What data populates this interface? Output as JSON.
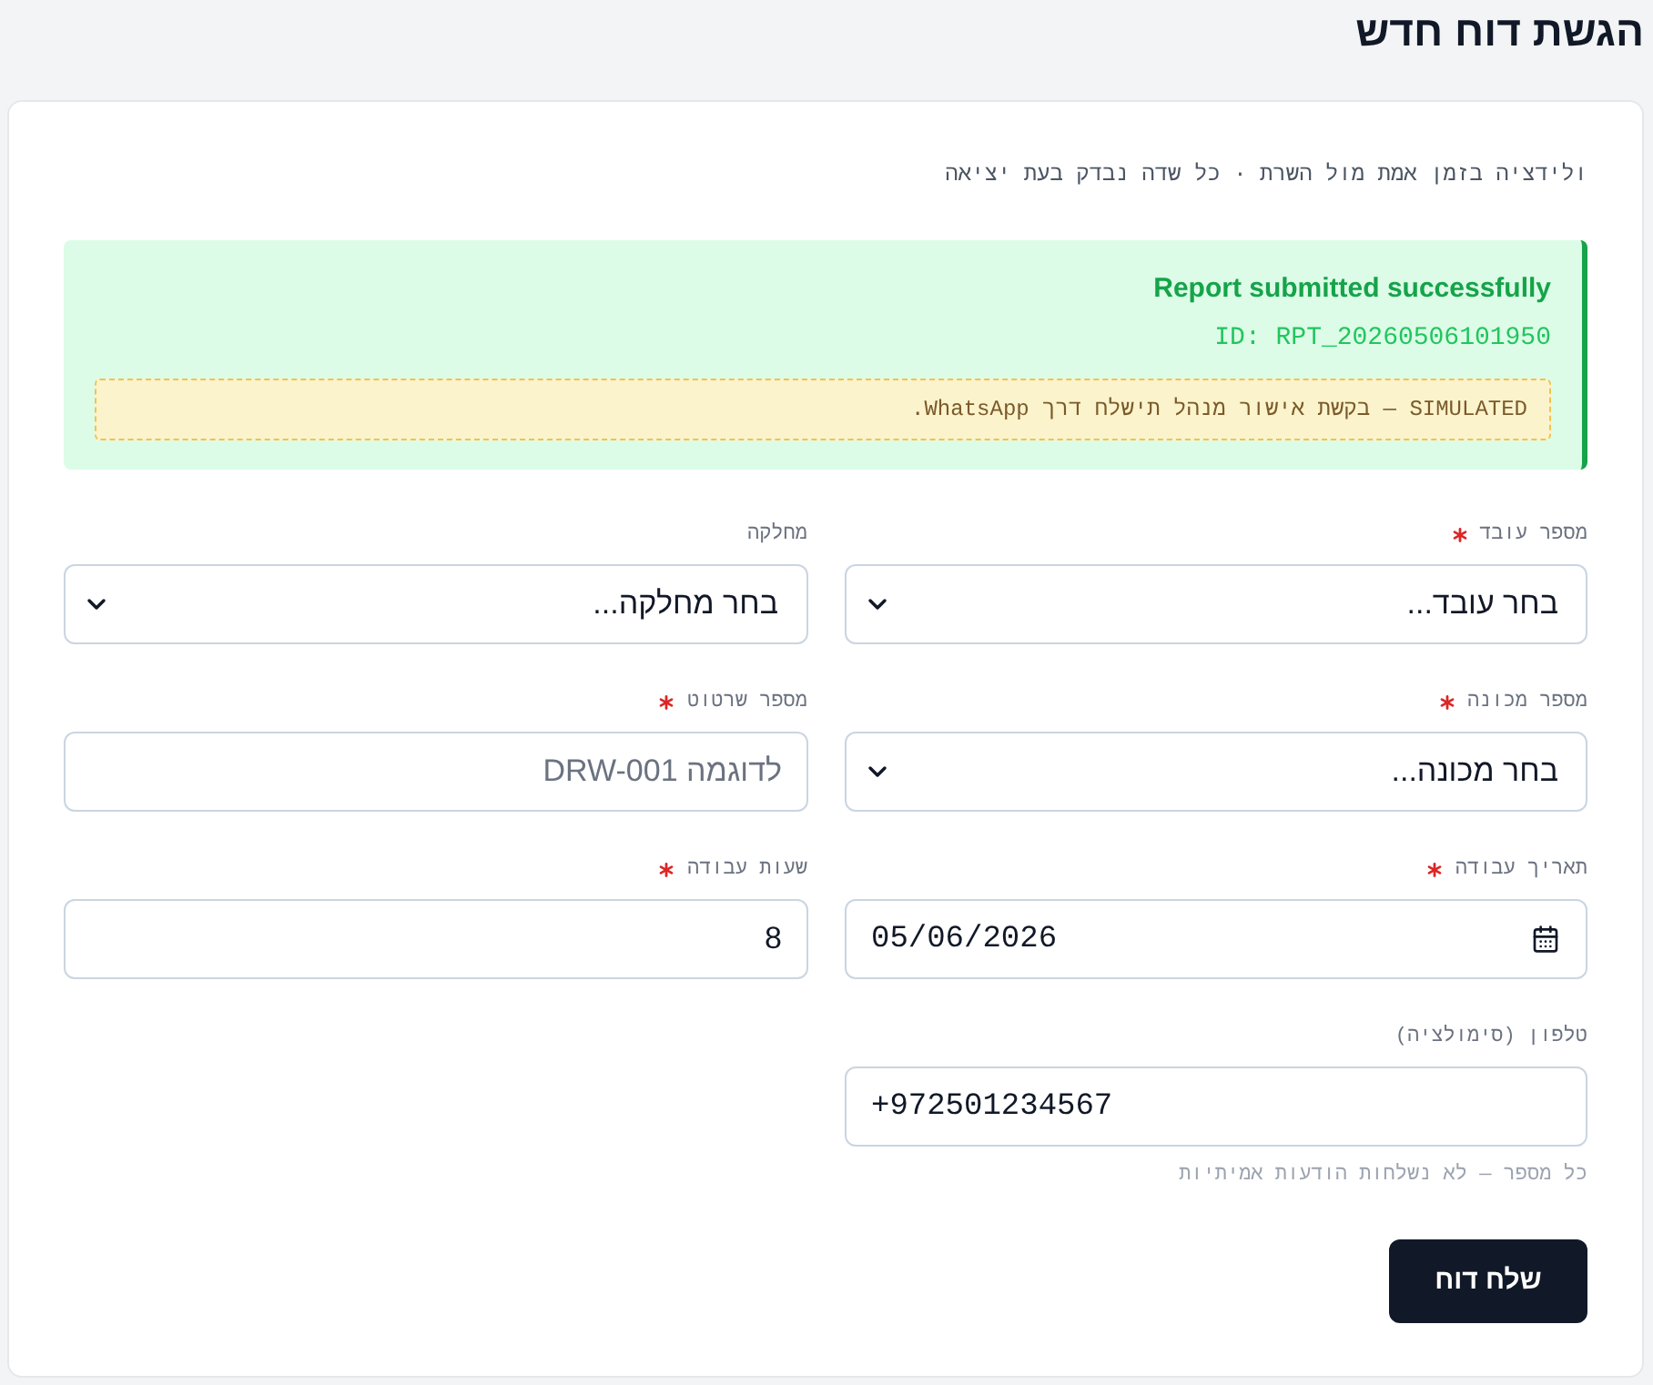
{
  "page": {
    "title": "הגשת דוח חדש",
    "subtitle": "ולידציה בזמן אמת מול השרת · כל שדה נבדק בעת יציאה"
  },
  "alert": {
    "title": "Report submitted successfully",
    "id": "ID: RPT_20260506101950",
    "note": "SIMULATED — בקשת אישור מנהל תישלח דרך WhatsApp."
  },
  "fields": [
    {
      "kind": "select",
      "label": "מספר עובד",
      "required": true,
      "placeholder": "בחר עובד..."
    },
    {
      "kind": "select",
      "label": "מחלקה",
      "required": false,
      "placeholder": "בחר מחלקה..."
    },
    {
      "kind": "select",
      "label": "מספר מכונה",
      "required": true,
      "placeholder": "בחר מכונה..."
    },
    {
      "kind": "text",
      "label": "מספר שרטוט",
      "required": true,
      "placeholder": "לדוגמה DRW-001"
    },
    {
      "kind": "date",
      "label": "תאריך עבודה",
      "required": true,
      "value": "05/06/2026"
    },
    {
      "kind": "number",
      "label": "שעות עבודה",
      "required": true,
      "value": "8"
    },
    {
      "kind": "tel",
      "label": "טלפון (סימולציה)",
      "required": false,
      "value": "+972501234567",
      "hint": "כל מספר — לא נשלחות הודעות אמיתיות"
    }
  ],
  "submit": {
    "label": "שלח דוח"
  }
}
